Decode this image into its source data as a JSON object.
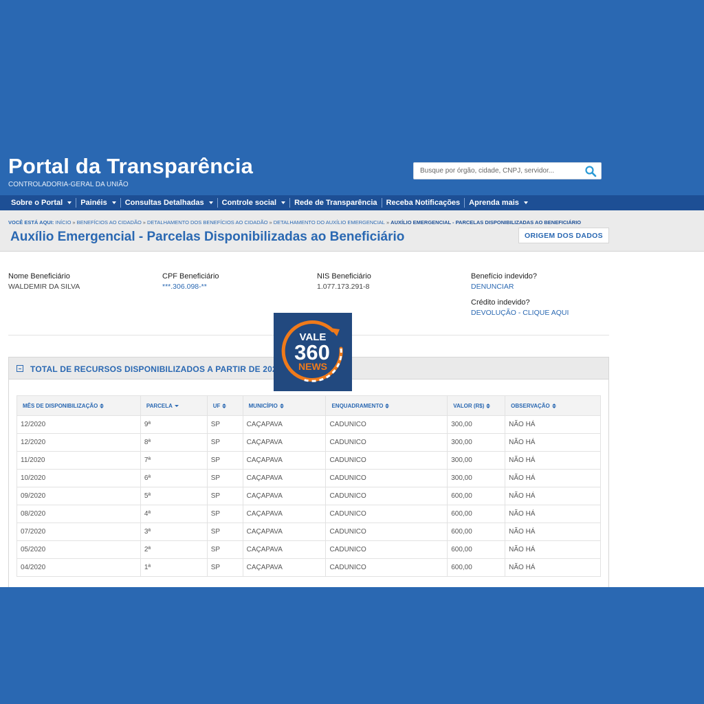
{
  "header": {
    "title": "Portal da Transparência",
    "subtitle": "CONTROLADORIA-GERAL DA UNIÃO",
    "search_placeholder": "Busque por órgão, cidade, CNPJ, servidor..."
  },
  "nav": [
    {
      "label": "Sobre o Portal",
      "dropdown": true
    },
    {
      "label": "Painéis",
      "dropdown": true
    },
    {
      "label": "Consultas Detalhadas",
      "dropdown": true
    },
    {
      "label": "Controle social",
      "dropdown": true
    },
    {
      "label": "Rede de Transparência",
      "dropdown": false
    },
    {
      "label": "Receba Notificações",
      "dropdown": false
    },
    {
      "label": "Aprenda mais",
      "dropdown": true
    }
  ],
  "breadcrumb": {
    "lead": "Você está aqui:",
    "items": [
      "Início",
      "Benefícios ao cidadão",
      "Detalhamento dos benefícios ao cidadão",
      "Detalhamento do auxílio emergencial"
    ],
    "current": "Auxílio Emergencial - Parcelas Disponibilizadas ao Beneficiário"
  },
  "page": {
    "title": "Auxílio Emergencial - Parcelas Disponibilizadas ao Beneficiário",
    "origem_label": "ORIGEM DOS DADOS"
  },
  "beneficiary": {
    "nome_label": "Nome Beneficiário",
    "nome_value": "WALDEMIR DA SILVA",
    "cpf_label": "CPF Beneficiário",
    "cpf_value": "***.306.098-**",
    "nis_label": "NIS Beneficiário",
    "nis_value": "1.077.173.291-8",
    "indevido_label": "Benefício indevido?",
    "denunciar_link": "DENUNCIAR",
    "credito_label": "Crédito indevido?",
    "devolucao_link": "DEVOLUÇÃO - CLIQUE AQUI"
  },
  "panel": {
    "title": "TOTAL DE RECURSOS DISPONIBILIZADOS A PARTIR DE 2020"
  },
  "table": {
    "columns": [
      "Mês de disponibilização",
      "Parcela",
      "UF",
      "Município",
      "Enquadramento",
      "Valor (R$)",
      "Observação"
    ],
    "rows": [
      [
        "12/2020",
        "9ª",
        "SP",
        "CAÇAPAVA",
        "CADUNICO",
        "300,00",
        "NÃO HÁ"
      ],
      [
        "12/2020",
        "8ª",
        "SP",
        "CAÇAPAVA",
        "CADUNICO",
        "300,00",
        "NÃO HÁ"
      ],
      [
        "11/2020",
        "7ª",
        "SP",
        "CAÇAPAVA",
        "CADUNICO",
        "300,00",
        "NÃO HÁ"
      ],
      [
        "10/2020",
        "6ª",
        "SP",
        "CAÇAPAVA",
        "CADUNICO",
        "300,00",
        "NÃO HÁ"
      ],
      [
        "09/2020",
        "5ª",
        "SP",
        "CAÇAPAVA",
        "CADUNICO",
        "600,00",
        "NÃO HÁ"
      ],
      [
        "08/2020",
        "4ª",
        "SP",
        "CAÇAPAVA",
        "CADUNICO",
        "600,00",
        "NÃO HÁ"
      ],
      [
        "07/2020",
        "3ª",
        "SP",
        "CAÇAPAVA",
        "CADUNICO",
        "600,00",
        "NÃO HÁ"
      ],
      [
        "05/2020",
        "2ª",
        "SP",
        "CAÇAPAVA",
        "CADUNICO",
        "600,00",
        "NÃO HÁ"
      ],
      [
        "04/2020",
        "1ª",
        "SP",
        "CAÇAPAVA",
        "CADUNICO",
        "600,00",
        "NÃO HÁ"
      ]
    ]
  },
  "logo": {
    "line1": "VALE",
    "line2": "360",
    "line3": "NEWS"
  },
  "colors": {
    "brand_blue": "#2a68b2",
    "nav_blue": "#1d4f95",
    "logo_orange": "#f07a1a"
  }
}
